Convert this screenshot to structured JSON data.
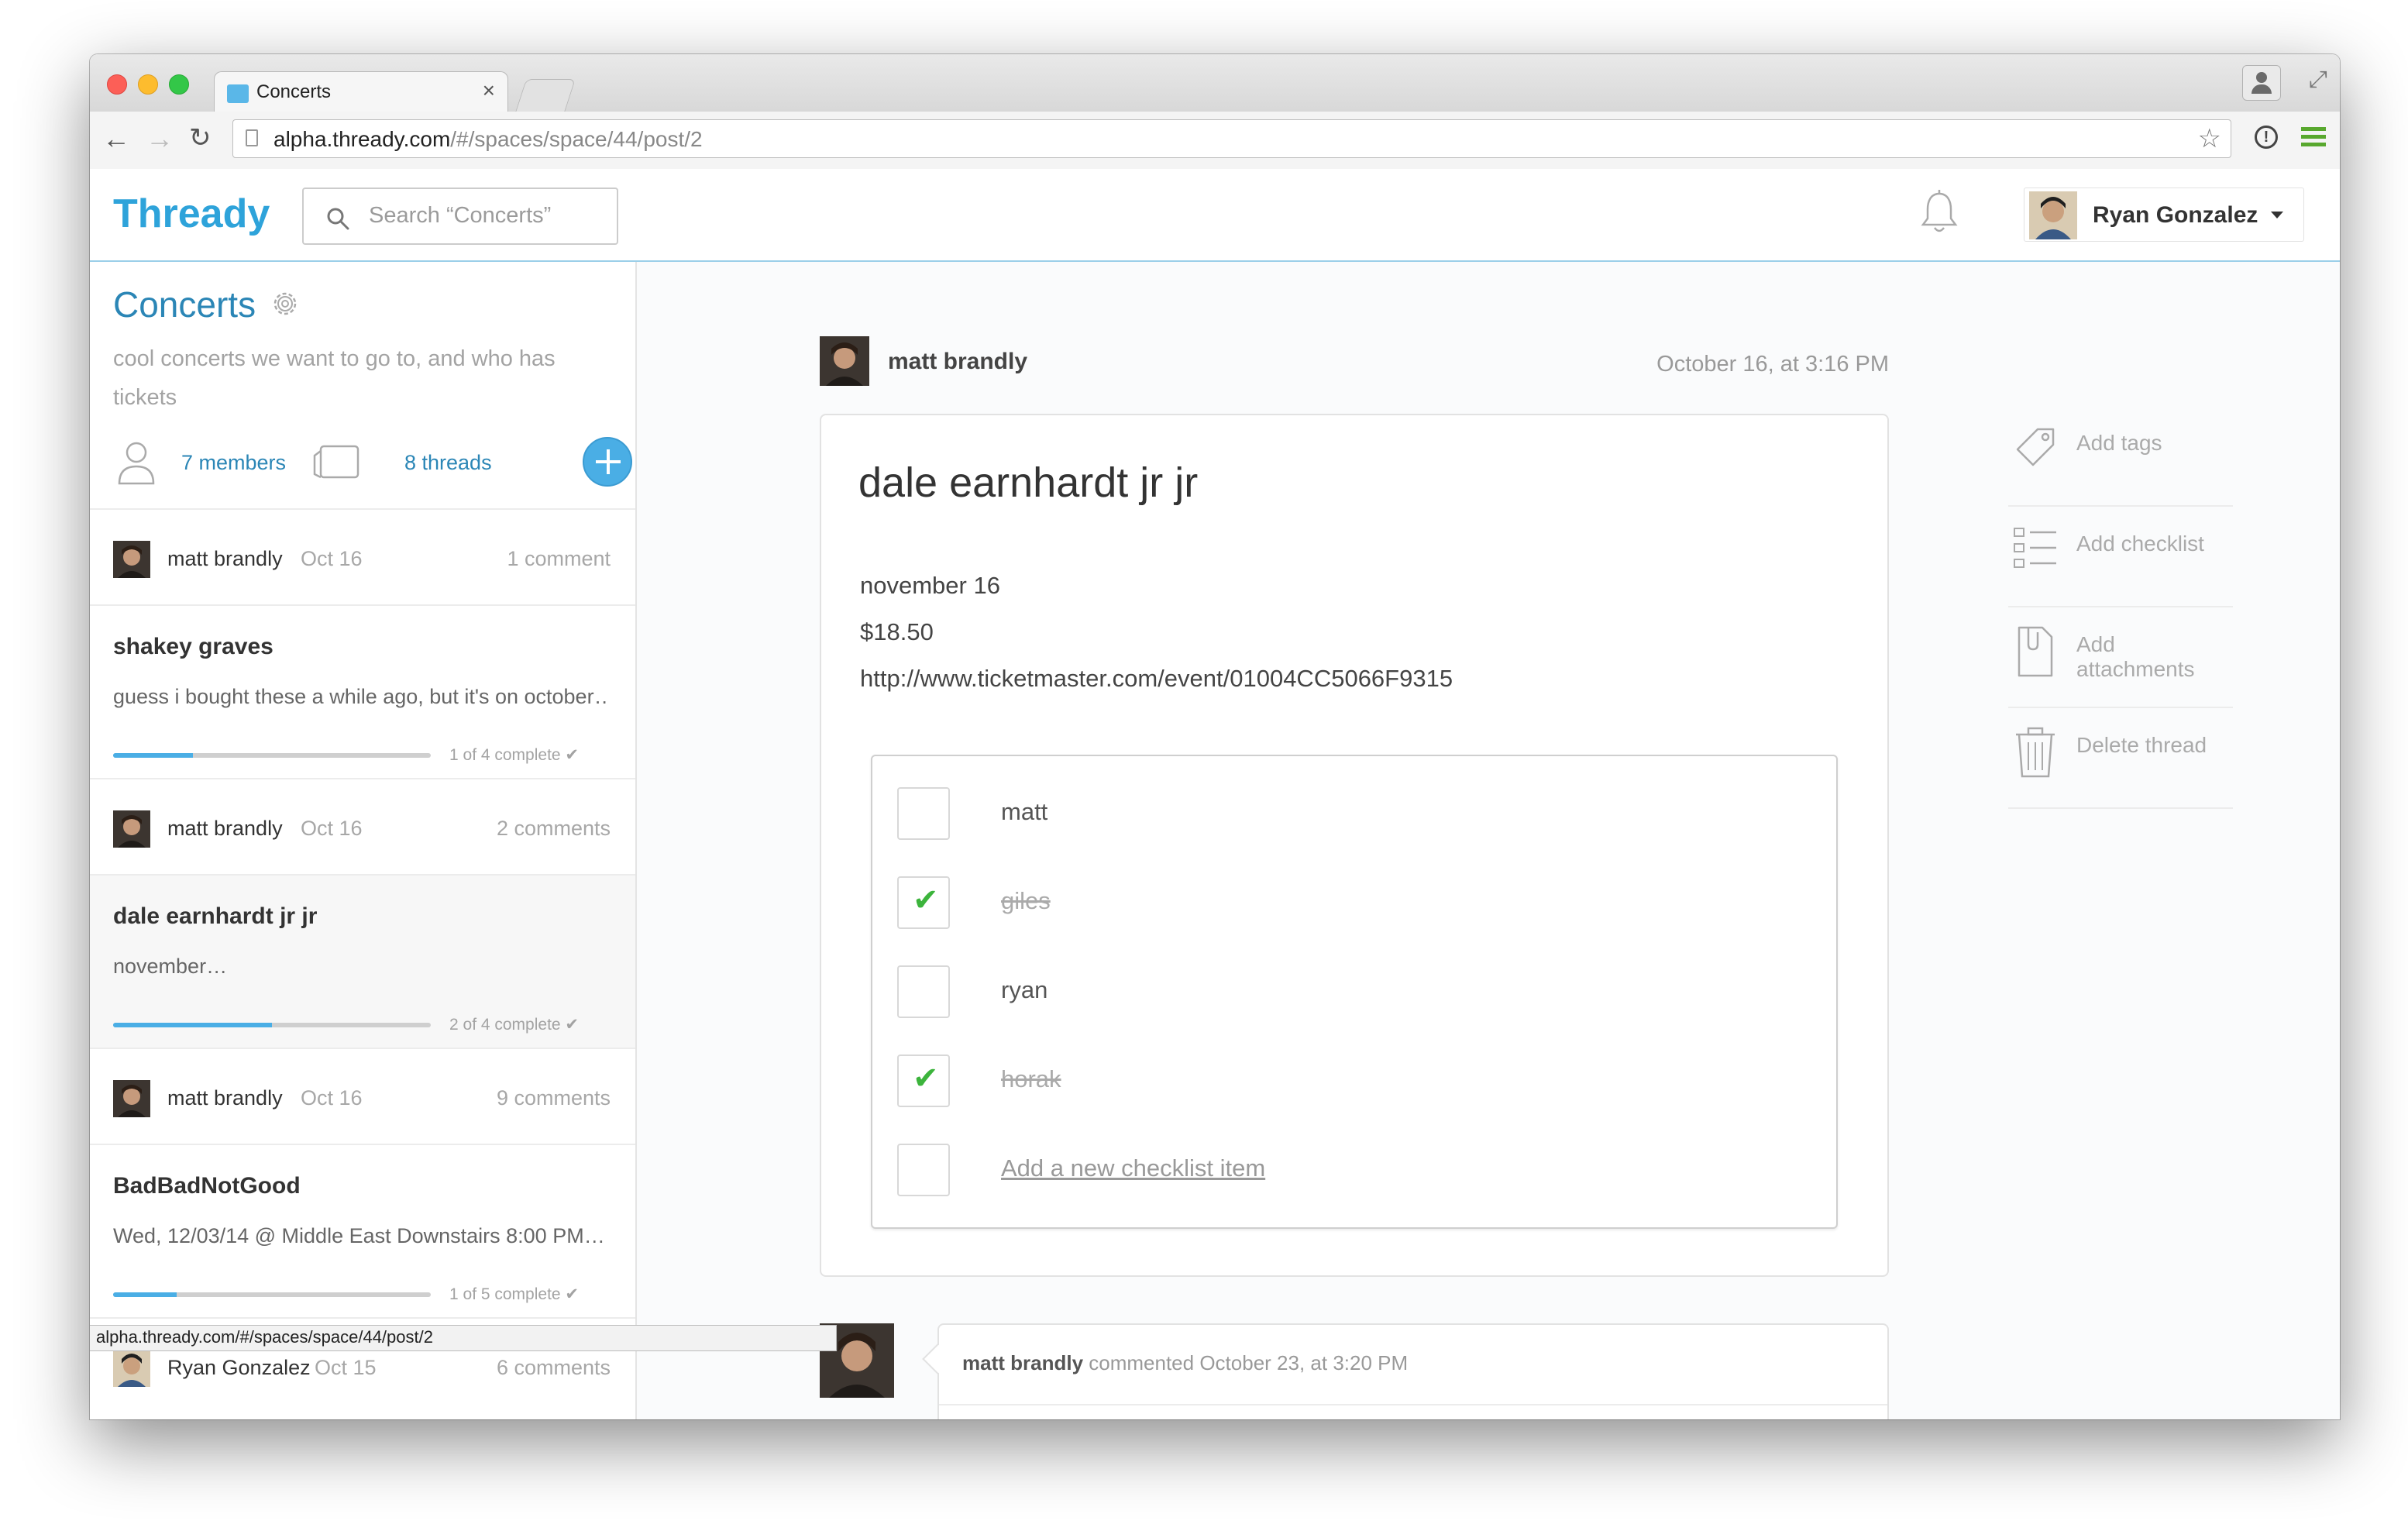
{
  "browser": {
    "tab_title": "Concerts",
    "tab_close": "×",
    "url_host": "alpha.thready.com",
    "url_path": "/#/spaces/space/44/post/2",
    "status_url": "alpha.thready.com/#/spaces/space/44/post/2"
  },
  "app": {
    "brand": "Thready",
    "search_placeholder": "Search “Concerts”",
    "user_name": "Ryan Gonzalez",
    "accent_color": "#2ea3da"
  },
  "space": {
    "title": "Concerts",
    "description": "cool concerts we want to go to, and who has tickets",
    "members_label": "7 members",
    "threads_label": "8 threads"
  },
  "threads": [
    {
      "meta": {
        "author": "matt brandly",
        "date": "Oct 16",
        "comments": "1 comment"
      },
      "title": "shakey graves",
      "excerpt": "guess i bought these a while ago, but it's on october…",
      "progress_fraction": 0.25,
      "progress_label": "1 of 4 complete ✔",
      "selected": false
    },
    {
      "meta": {
        "author": "matt brandly",
        "date": "Oct 16",
        "comments": "2 comments"
      },
      "title": "dale earnhardt jr jr",
      "excerpt": "november…",
      "progress_fraction": 0.5,
      "progress_label": "2 of 4 complete ✔",
      "selected": true
    },
    {
      "meta": {
        "author": "matt brandly",
        "date": "Oct 16",
        "comments": "9 comments"
      },
      "title": "BadBadNotGood",
      "excerpt": "Wed, 12/03/14 @ Middle East Downstairs 8:00 PM…",
      "progress_fraction": 0.2,
      "progress_label": "1 of 5 complete ✔",
      "selected": false
    },
    {
      "meta": {
        "author": "Ryan Gonzalez",
        "date": "Oct 15",
        "comments": "6 comments"
      }
    }
  ],
  "post": {
    "author": "matt brandly",
    "date": "October 16, at 3:16 PM",
    "title": "dale earnhardt jr jr",
    "lines": [
      "november 16",
      "$18.50",
      "http://www.ticketmaster.com/event/01004CC5066F9315"
    ],
    "checklist": [
      {
        "label": "matt",
        "done": false
      },
      {
        "label": "giles",
        "done": true
      },
      {
        "label": "ryan",
        "done": false
      },
      {
        "label": "horak",
        "done": true
      }
    ],
    "checklist_add": "Add a new checklist item",
    "check_glyph": "✔"
  },
  "actions": {
    "add_tags": "Add tags",
    "add_checklist": "Add checklist",
    "add_attachments": "Add attachments",
    "delete_thread": "Delete thread"
  },
  "comment": {
    "author": "matt brandly",
    "meta": "commented October 23, at 3:20 PM"
  }
}
